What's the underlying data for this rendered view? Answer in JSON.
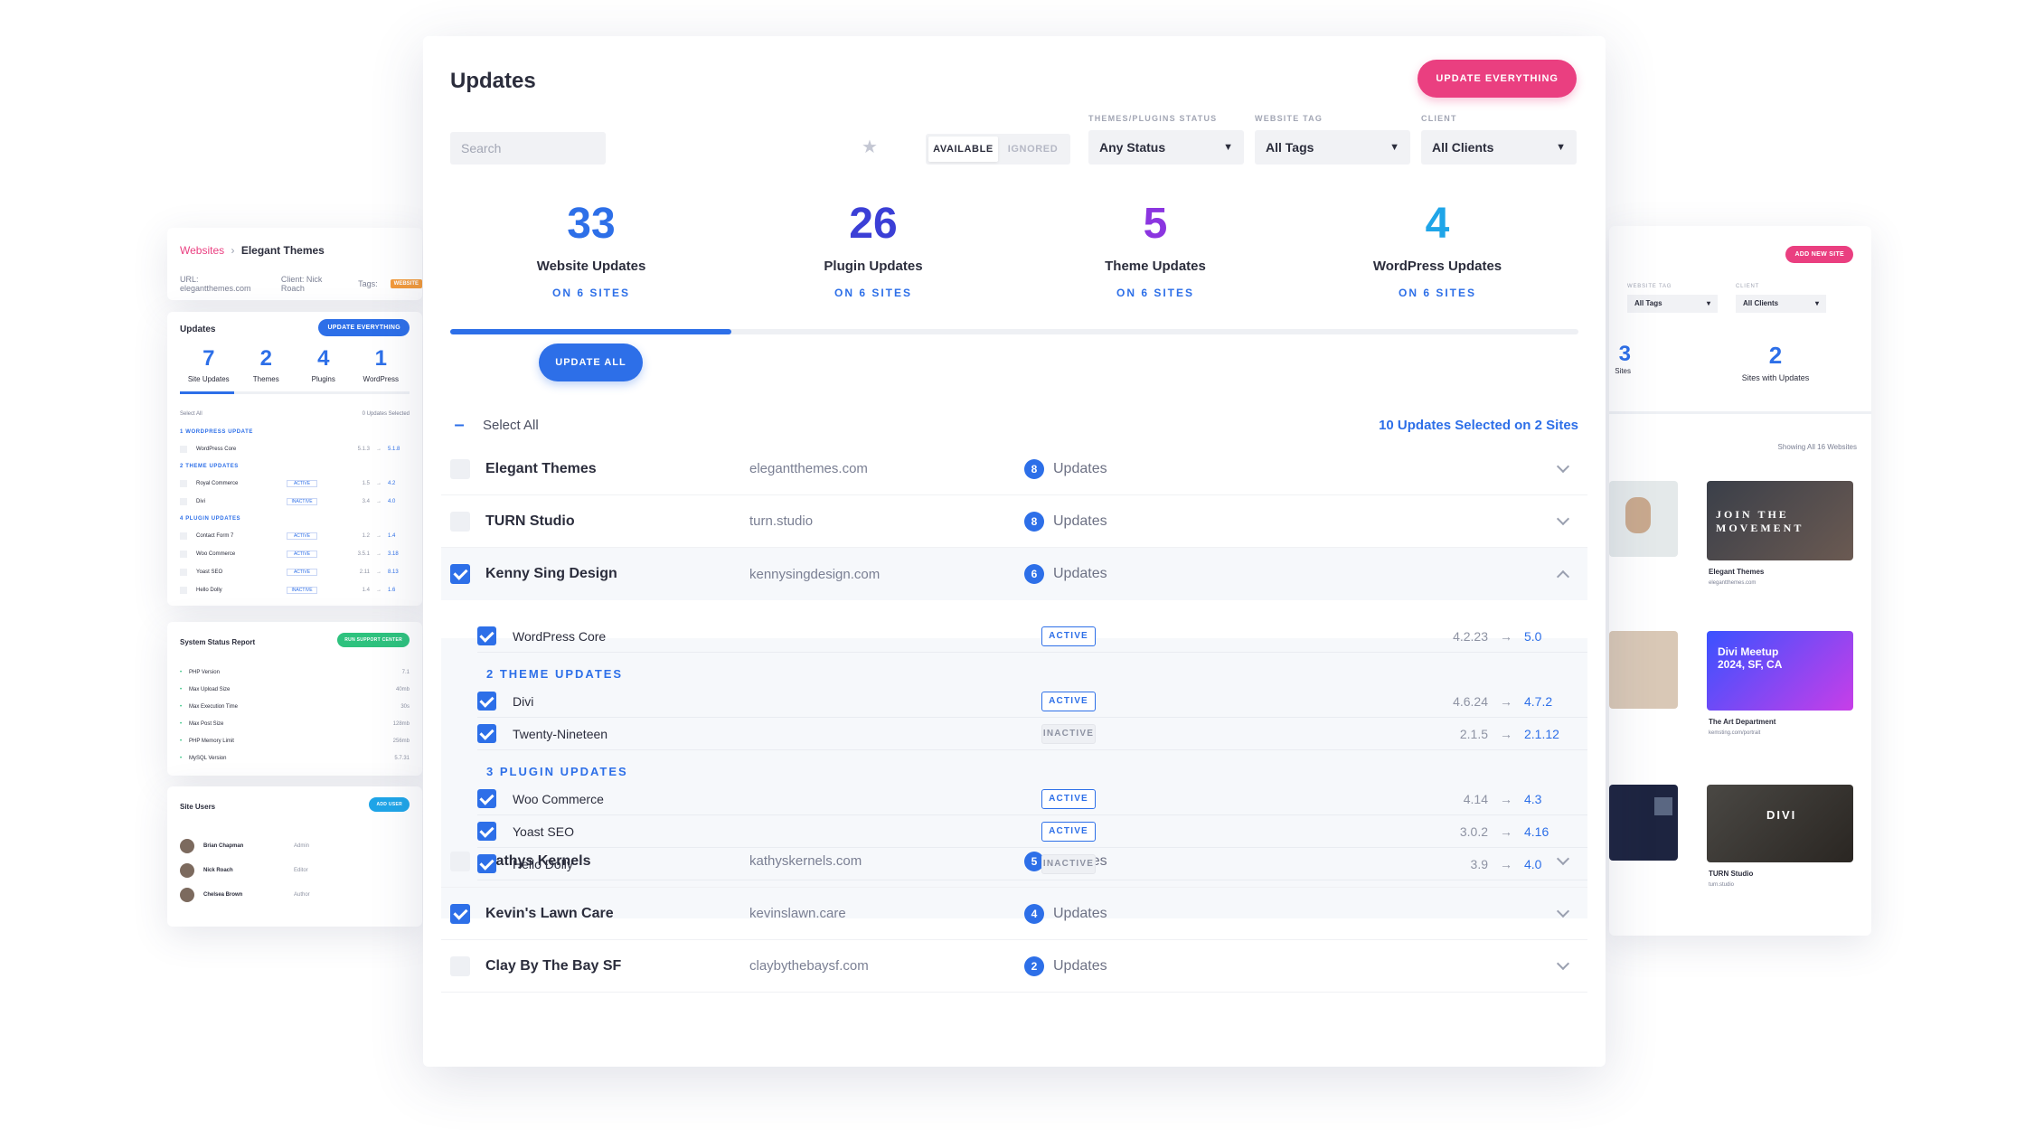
{
  "left_header": {
    "breadcrumb_root": "Websites",
    "breadcrumb_sep": "›",
    "breadcrumb_current": "Elegant Themes",
    "meta_url": "URL: elegantthemes.com",
    "meta_client": "Client: Nick Roach",
    "meta_tags": "Tags:",
    "tag": "WEBSITE"
  },
  "left_updates": {
    "title": "Updates",
    "button": "UPDATE EVERYTHING",
    "stats": [
      {
        "num": "7",
        "label": "Site Updates"
      },
      {
        "num": "2",
        "label": "Themes"
      },
      {
        "num": "4",
        "label": "Plugins"
      },
      {
        "num": "1",
        "label": "WordPress"
      }
    ],
    "select_all": "Select All",
    "selected": "0 Updates Selected",
    "groups": [
      {
        "title": "1 WORDPRESS UPDATE",
        "rows": [
          {
            "name": "WordPress Core",
            "status": "",
            "from": "5.1.3",
            "to": "5.1.8"
          }
        ]
      },
      {
        "title": "2 THEME UPDATES",
        "rows": [
          {
            "name": "Royal Commerce",
            "status": "ACTIVE",
            "from": "1.5",
            "to": "4.2"
          },
          {
            "name": "Divi",
            "status": "INACTIVE",
            "from": "3.4",
            "to": "4.0"
          }
        ]
      },
      {
        "title": "4 PLUGIN UPDATES",
        "rows": [
          {
            "name": "Contact Form 7",
            "status": "ACTIVE",
            "from": "1.2",
            "to": "1.4"
          },
          {
            "name": "Woo Commerce",
            "status": "ACTIVE",
            "from": "3.5.1",
            "to": "3.18"
          },
          {
            "name": "Yoast SEO",
            "status": "ACTIVE",
            "from": "2.11",
            "to": "8.13"
          },
          {
            "name": "Hello Dolly",
            "status": "INACTIVE",
            "from": "1.4",
            "to": "1.6"
          }
        ]
      }
    ]
  },
  "left_system": {
    "title": "System Status Report",
    "button": "RUN SUPPORT CENTER",
    "rows": [
      {
        "label": "PHP Version",
        "value": "7.1"
      },
      {
        "label": "Max Upload Size",
        "value": "40mb"
      },
      {
        "label": "Max Execution Time",
        "value": "30s"
      },
      {
        "label": "Max Post Size",
        "value": "128mb"
      },
      {
        "label": "PHP Memory Limit",
        "value": "256mb"
      },
      {
        "label": "MySQL Version",
        "value": "5.7.31"
      }
    ]
  },
  "left_users": {
    "title": "Site Users",
    "button": "ADD USER",
    "users": [
      {
        "name": "Brian Chapman",
        "role": "Admin"
      },
      {
        "name": "Nick Roach",
        "role": "Editor"
      },
      {
        "name": "Chelsea Brown",
        "role": "Author"
      }
    ]
  },
  "right_card": {
    "button": "ADD NEW SITE",
    "filter1_label": "WEBSITE TAG",
    "filter1_value": "All Tags",
    "filter2_label": "CLIENT",
    "filter2_value": "All Clients",
    "stat_partial_num": "3",
    "stat_partial_label": "Sites",
    "stat_num": "2",
    "stat_label": "Sites with Updates",
    "showing": "Showing All 16 Websites",
    "thumbs": [
      {
        "title": "Elegant Themes",
        "url": "elegantthemes.com",
        "art": "JOIN THE MOVEMENT"
      },
      {
        "title": "The Art Department",
        "url": "kemsting.com/portrait",
        "art": "Divi Meetup 2024, SF, CA"
      },
      {
        "title": "TURN Studio",
        "url": "turn.studio",
        "art": "DIVI"
      }
    ]
  },
  "main": {
    "title": "Updates",
    "update_everything": "UPDATE EVERYTHING",
    "search_placeholder": "Search",
    "toggle": {
      "available": "AVAILABLE",
      "ignored": "IGNORED"
    },
    "filters": [
      {
        "label": "THEMES/PLUGINS STATUS",
        "value": "Any Status"
      },
      {
        "label": "WEBSITE TAG",
        "value": "All Tags"
      },
      {
        "label": "CLIENT",
        "value": "All Clients"
      }
    ],
    "stats": [
      {
        "num": "33",
        "label": "Website Updates",
        "sub": "ON 6 SITES",
        "color": "#2d6fe8"
      },
      {
        "num": "26",
        "label": "Plugin Updates",
        "sub": "ON 6 SITES",
        "color": "#3b3fd6"
      },
      {
        "num": "5",
        "label": "Theme Updates",
        "sub": "ON 6 SITES",
        "color": "#8b35e0"
      },
      {
        "num": "4",
        "label": "WordPress Updates",
        "sub": "ON 6 SITES",
        "color": "#1fa5e8"
      }
    ],
    "update_all": "UPDATE ALL",
    "select_all": "Select All",
    "selected_summary": "10 Updates Selected on 2 Sites",
    "updates_word": "Updates",
    "sites": [
      {
        "name": "Elegant Themes",
        "domain": "elegantthemes.com",
        "count": "8",
        "checked": false
      },
      {
        "name": "TURN Studio",
        "domain": "turn.studio",
        "count": "8",
        "checked": false
      },
      {
        "name": "Kenny Sing Design",
        "domain": "kennysingdesign.com",
        "count": "6",
        "checked": true
      },
      {
        "name": "Kathys Kernels",
        "domain": "kathyskernels.com",
        "count": "5",
        "checked": false
      },
      {
        "name": "Kevin's Lawn Care",
        "domain": "kevinslawn.care",
        "count": "4",
        "checked": true
      },
      {
        "name": "Clay By The Bay SF",
        "domain": "claybythebaysf.com",
        "count": "2",
        "checked": false
      }
    ],
    "expanded": {
      "core": {
        "name": "WordPress Core",
        "status": "ACTIVE",
        "from": "4.2.23",
        "to": "5.0"
      },
      "theme_group": "2 THEME UPDATES",
      "themes": [
        {
          "name": "Divi",
          "status": "ACTIVE",
          "from": "4.6.24",
          "to": "4.7.2"
        },
        {
          "name": "Twenty-Nineteen",
          "status": "INACTIVE",
          "from": "2.1.5",
          "to": "2.1.12"
        }
      ],
      "plugin_group": "3 PLUGIN UPDATES",
      "plugins": [
        {
          "name": "Woo Commerce",
          "status": "ACTIVE",
          "from": "4.14",
          "to": "4.3"
        },
        {
          "name": "Yoast SEO",
          "status": "ACTIVE",
          "from": "3.0.2",
          "to": "4.16"
        },
        {
          "name": "Hello Dolly",
          "status": "INACTIVE",
          "from": "3.9",
          "to": "4.0"
        }
      ],
      "arrow": "→"
    }
  }
}
